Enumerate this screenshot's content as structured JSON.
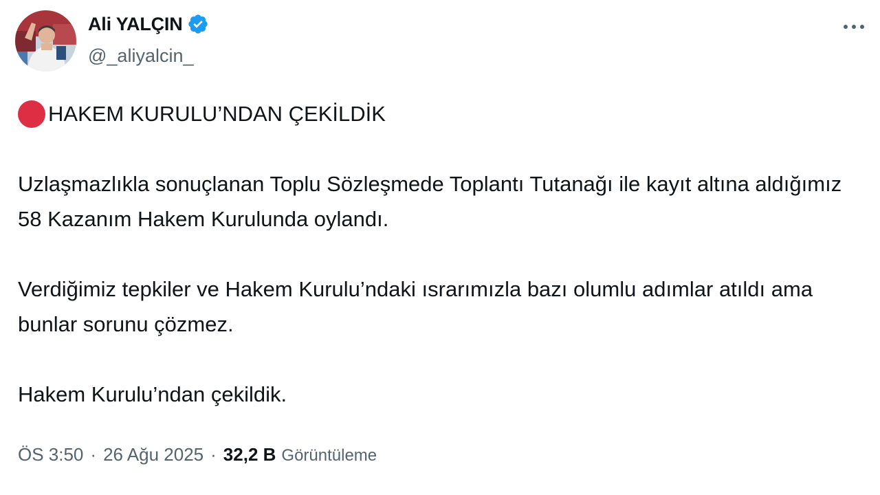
{
  "author": {
    "display_name": "Ali YALÇIN",
    "handle": "@_aliyalcin_",
    "verified": true
  },
  "icons": {
    "verified": "verified-badge-icon",
    "more": "more-dots-icon",
    "bullet": "red-circle-icon"
  },
  "colors": {
    "verified_badge": "#1d9bf0",
    "red_circle": "#dd2e44",
    "secondary_text": "#536471",
    "primary_text": "#0f1419"
  },
  "tweet": {
    "headline": "HAKEM KURULU’NDAN ÇEKİLDİK",
    "paragraphs": [
      "Uzlaşmazlıkla sonuçlanan Toplu Sözleşmede Toplantı Tutanağı ile kayıt altına aldığımız 58 Kazanım Hakem Kurulunda oylandı.",
      "Verdiğimiz tepkiler ve Hakem Kurulu’ndaki ısrarımızla bazı olumlu adımlar atıldı ama bunlar sorunu çözmez.",
      "Hakem Kurulu’ndan çekildik."
    ]
  },
  "meta": {
    "time": "ÖS 3:50",
    "separator": "·",
    "date": "26 Ağu 2025",
    "views_count": "32,2 B",
    "views_label": "Görüntüleme"
  }
}
